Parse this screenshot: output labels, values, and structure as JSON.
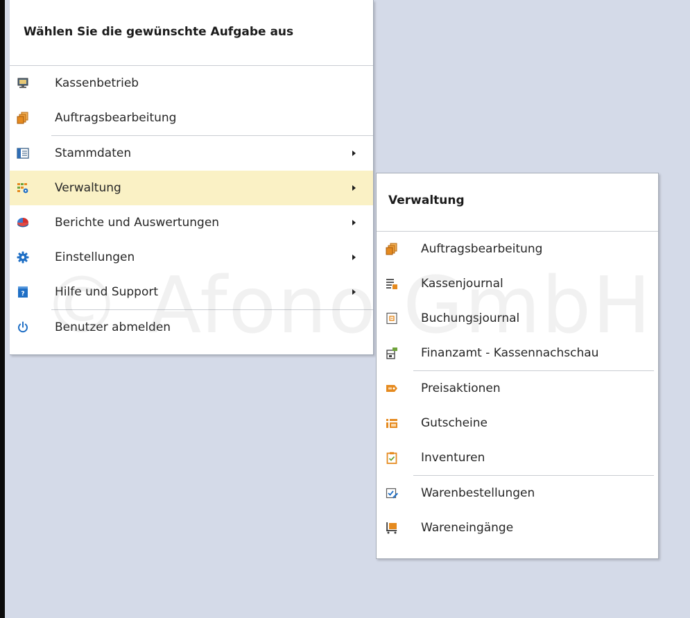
{
  "main_menu": {
    "title": "Wählen Sie die gewünschte Aufgabe aus",
    "items": [
      {
        "label": "Kassenbetrieb",
        "icon": "monitor-icon"
      },
      {
        "label": "Auftragsbearbeitung",
        "icon": "documents-icon"
      },
      {
        "label": "Stammdaten",
        "icon": "table-icon",
        "has_submenu": true
      },
      {
        "label": "Verwaltung",
        "icon": "management-icon",
        "has_submenu": true,
        "highlighted": true
      },
      {
        "label": "Berichte und Auswertungen",
        "icon": "pie-chart-icon",
        "has_submenu": true
      },
      {
        "label": "Einstellungen",
        "icon": "gear-icon",
        "has_submenu": true
      },
      {
        "label": "Hilfe und Support",
        "icon": "help-icon",
        "has_submenu": true
      },
      {
        "label": "Benutzer abmelden",
        "icon": "power-icon"
      }
    ]
  },
  "submenu": {
    "title": "Verwaltung",
    "items": [
      {
        "label": "Auftragsbearbeitung",
        "icon": "documents-icon"
      },
      {
        "label": "Kassenjournal",
        "icon": "journal-icon"
      },
      {
        "label": "Buchungsjournal",
        "icon": "booking-journal-icon"
      },
      {
        "label": "Finanzamt - Kassennachschau",
        "icon": "tax-office-icon"
      },
      {
        "label": "Preisaktionen",
        "icon": "price-tag-icon"
      },
      {
        "label": "Gutscheine",
        "icon": "voucher-icon"
      },
      {
        "label": "Inventuren",
        "icon": "clipboard-icon"
      },
      {
        "label": "Warenbestellungen",
        "icon": "order-edit-icon"
      },
      {
        "label": "Wareneingänge",
        "icon": "goods-cart-icon"
      }
    ]
  },
  "watermark": "© Afono GmbH",
  "colors": {
    "background": "#d4dae8",
    "highlight": "#faf1c5",
    "accent_blue": "#1f6fc5",
    "accent_orange": "#e58a1f"
  }
}
